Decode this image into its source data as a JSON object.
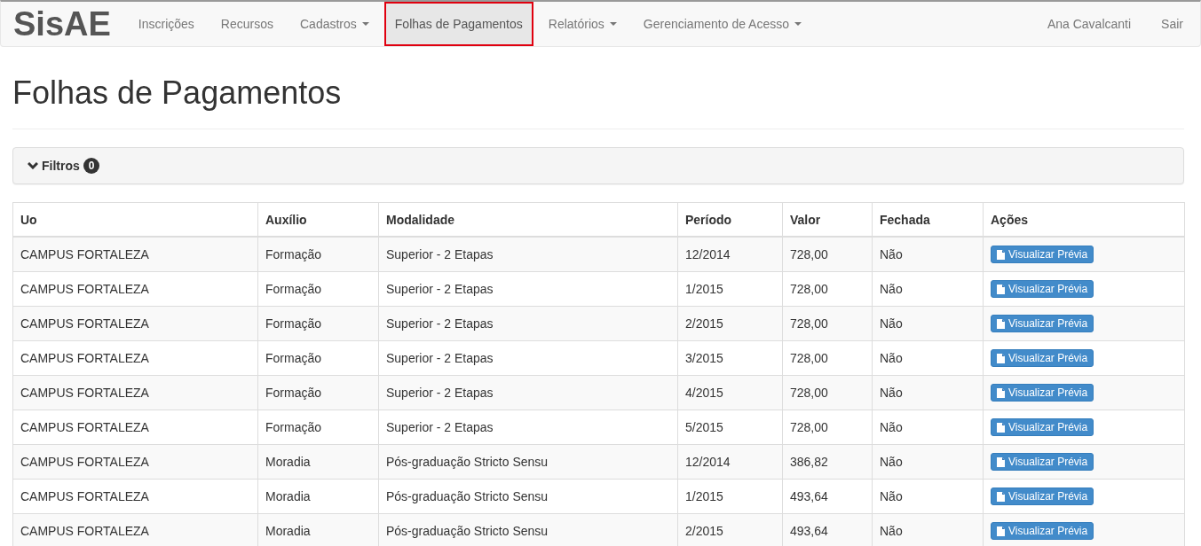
{
  "navbar": {
    "brand": "SisAE",
    "items": [
      {
        "label": "Inscrições",
        "dropdown": false,
        "selected": false
      },
      {
        "label": "Recursos",
        "dropdown": false,
        "selected": false
      },
      {
        "label": "Cadastros",
        "dropdown": true,
        "selected": false
      },
      {
        "label": "Folhas de Pagamentos",
        "dropdown": false,
        "selected": true
      },
      {
        "label": "Relatórios",
        "dropdown": true,
        "selected": false
      },
      {
        "label": "Gerenciamento de Acesso",
        "dropdown": true,
        "selected": false
      }
    ],
    "right_items": [
      "Ana Cavalcanti",
      "Sair"
    ]
  },
  "page_title": "Folhas de Pagamentos",
  "filters": {
    "label": "Filtros",
    "count": "0",
    "expanded": false
  },
  "table": {
    "columns": [
      "Uo",
      "Auxílio",
      "Modalidade",
      "Período",
      "Valor",
      "Fechada",
      "Ações"
    ],
    "rows": [
      [
        "CAMPUS FORTALEZA",
        "Formação",
        "Superior - 2 Etapas",
        "12/2014",
        "728,00",
        "Não",
        "Visualizar Prévia"
      ],
      [
        "CAMPUS FORTALEZA",
        "Formação",
        "Superior - 2 Etapas",
        "1/2015",
        "728,00",
        "Não",
        "Visualizar Prévia"
      ],
      [
        "CAMPUS FORTALEZA",
        "Formação",
        "Superior - 2 Etapas",
        "2/2015",
        "728,00",
        "Não",
        "Visualizar Prévia"
      ],
      [
        "CAMPUS FORTALEZA",
        "Formação",
        "Superior - 2 Etapas",
        "3/2015",
        "728,00",
        "Não",
        "Visualizar Prévia"
      ],
      [
        "CAMPUS FORTALEZA",
        "Formação",
        "Superior - 2 Etapas",
        "4/2015",
        "728,00",
        "Não",
        "Visualizar Prévia"
      ],
      [
        "CAMPUS FORTALEZA",
        "Formação",
        "Superior - 2 Etapas",
        "5/2015",
        "728,00",
        "Não",
        "Visualizar Prévia"
      ],
      [
        "CAMPUS FORTALEZA",
        "Moradia",
        "Pós-graduação Stricto Sensu",
        "12/2014",
        "386,82",
        "Não",
        "Visualizar Prévia"
      ],
      [
        "CAMPUS FORTALEZA",
        "Moradia",
        "Pós-graduação Stricto Sensu",
        "1/2015",
        "493,64",
        "Não",
        "Visualizar Prévia"
      ],
      [
        "CAMPUS FORTALEZA",
        "Moradia",
        "Pós-graduação Stricto Sensu",
        "2/2015",
        "493,64",
        "Não",
        "Visualizar Prévia"
      ]
    ]
  }
}
